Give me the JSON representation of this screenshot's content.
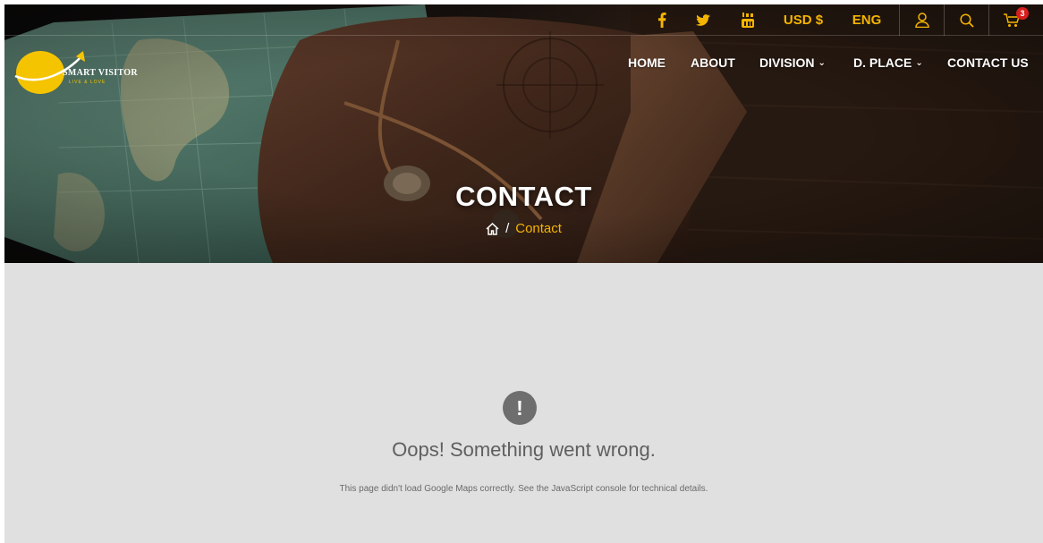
{
  "topbar": {
    "social": [
      {
        "icon": "facebook-icon"
      },
      {
        "icon": "twitter-icon"
      },
      {
        "icon": "youtube-icon"
      }
    ],
    "currency": "USD $",
    "language": "ENG",
    "account_icon": "user-icon",
    "search_icon": "search-icon",
    "cart_icon": "cart-icon",
    "cart_count": "3"
  },
  "logo": {
    "name": "SMART VISITOR",
    "tagline": "LIVE & LOVE"
  },
  "nav": {
    "items": [
      {
        "label": "HOME",
        "dropdown": false
      },
      {
        "label": "ABOUT",
        "dropdown": false
      },
      {
        "label": "DIVISION",
        "dropdown": true
      },
      {
        "label": "D. PLACE",
        "dropdown": true
      },
      {
        "label": "CONTACT US",
        "dropdown": false
      }
    ]
  },
  "hero": {
    "title": "CONTACT",
    "breadcrumb": {
      "home_icon": "home-icon",
      "separator": "/",
      "current": "Contact"
    }
  },
  "map_error": {
    "icon": "!",
    "title": "Oops! Something went wrong.",
    "message": "This page didn't load Google Maps correctly. See the JavaScript console for technical details."
  },
  "colors": {
    "accent": "#f5b400",
    "badge": "#d81d1d",
    "map_background": "#e0e0e0"
  }
}
